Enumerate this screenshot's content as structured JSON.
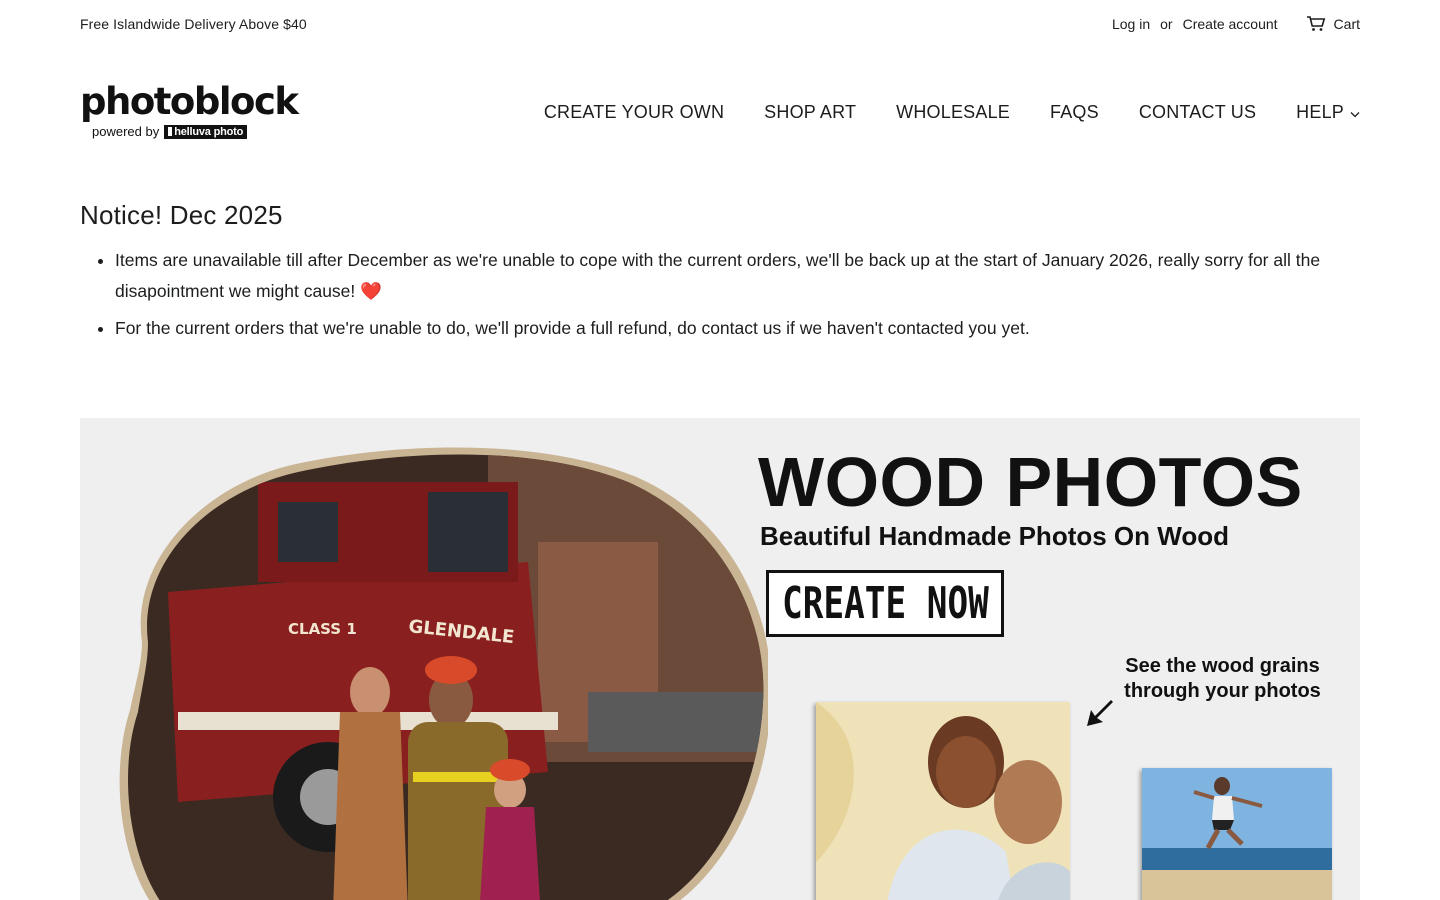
{
  "topbar": {
    "promo": "Free Islandwide Delivery Above $40",
    "login": "Log in",
    "or": "or",
    "create_account": "Create account",
    "cart": "Cart"
  },
  "header": {
    "logo_word": "photoblock",
    "logo_powered": "powered by",
    "logo_badge": "helluva photo"
  },
  "nav": {
    "items": [
      "CREATE YOUR OWN",
      "SHOP ART",
      "WHOLESALE",
      "FAQS",
      "CONTACT US"
    ],
    "help": "HELP"
  },
  "notice": {
    "title": "Notice! Dec 2025",
    "bullets": [
      "Items are unavailable till after December as we're unable to cope with the current orders, we'll be back up at the start of January 2026, really sorry for all the disapointment we might cause!",
      "For the current orders that we're unable to do, we'll provide a full refund, do contact us if we haven't contacted you yet."
    ],
    "heart": "❤️"
  },
  "hero": {
    "title": "WOOD PHOTOS",
    "subtitle": "Beautiful Handmade Photos On Wood",
    "cta": "CREATE NOW",
    "grain_line1": "See the wood grains",
    "grain_line2": "through your photos",
    "photo_texts": {
      "class": "CLASS 1",
      "glendale": "GLENDALE"
    }
  },
  "colors": {
    "text": "#1c1d1d",
    "hero_bg": "#efefef",
    "truck_red": "#8a1f1f",
    "heart": "#e0302a"
  },
  "icons": {
    "cart": "cart-icon",
    "help_chevron": "chevron-down-icon",
    "arrow": "arrow-down-left-icon"
  }
}
